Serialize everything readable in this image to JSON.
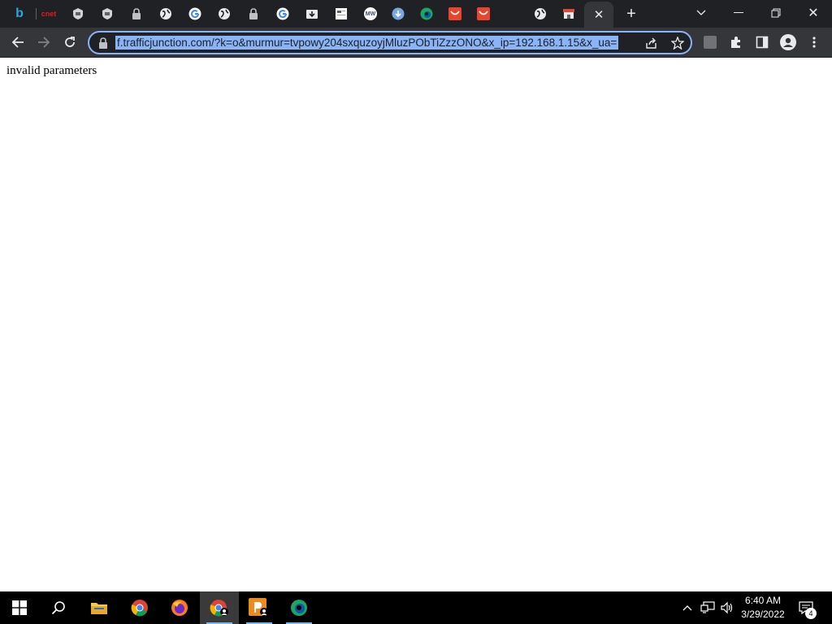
{
  "browser": {
    "tabs": [
      {
        "icon": "bing-icon"
      },
      {
        "icon": "cnet-icon",
        "text": "cnet"
      },
      {
        "icon": "shield-app-icon"
      },
      {
        "icon": "shield-app-icon"
      },
      {
        "icon": "lock-icon"
      },
      {
        "icon": "globe-icon"
      },
      {
        "icon": "google-icon"
      },
      {
        "icon": "globe-icon"
      },
      {
        "icon": "lock-icon"
      },
      {
        "icon": "google-icon"
      },
      {
        "icon": "folder-download-icon"
      },
      {
        "icon": "document-icon"
      },
      {
        "icon": "mw-icon",
        "text": "MW"
      },
      {
        "icon": "download-icon"
      },
      {
        "icon": "edge-icon"
      },
      {
        "icon": "red-app-icon"
      },
      {
        "icon": "red-app-icon"
      },
      {
        "icon": "globe-icon"
      },
      {
        "icon": "store-icon"
      },
      {
        "icon": "close-icon",
        "active": true
      }
    ],
    "url": "f.trafficjunction.com/?k=o&murmur=tvpowy204sxquzoyjMluzPObTiZzzONO&x_ip=192.168.1.15&x_ua="
  },
  "page": {
    "body_text": "invalid parameters"
  },
  "taskbar": {
    "time": "6:40 AM",
    "date": "3/29/2022",
    "notification_count": "4"
  }
}
